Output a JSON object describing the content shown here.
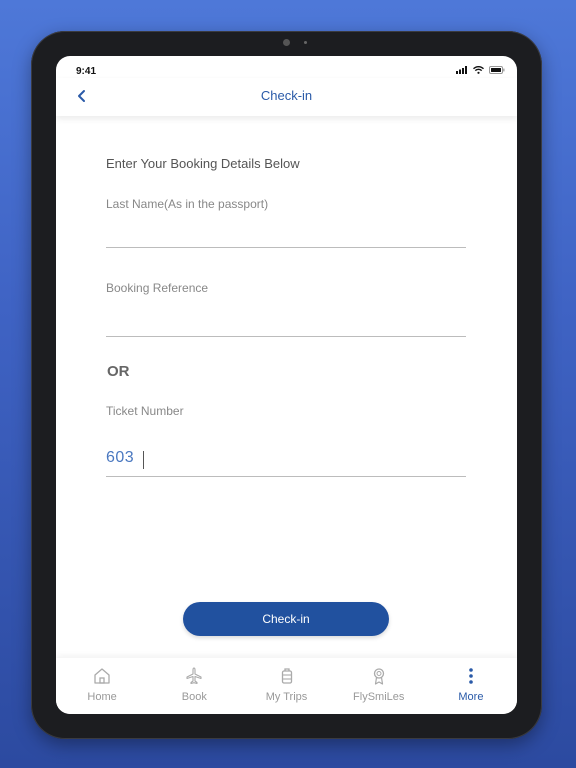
{
  "status": {
    "time": "9:41"
  },
  "navbar": {
    "title": "Check-in"
  },
  "form": {
    "heading": "Enter Your Booking Details Below",
    "last_name_label": "Last Name(As in the passport)",
    "last_name_value": "",
    "booking_ref_label": "Booking Reference",
    "booking_ref_value": "",
    "or_label": "OR",
    "ticket_label": "Ticket Number",
    "ticket_value": "603"
  },
  "button": {
    "checkin_label": "Check-in"
  },
  "colors": {
    "accent": "#2a5aa8",
    "button": "#21519f"
  },
  "tabs": [
    {
      "label": "Home",
      "icon": "home-icon"
    },
    {
      "label": "Book",
      "icon": "plane-icon"
    },
    {
      "label": "My Trips",
      "icon": "luggage-icon"
    },
    {
      "label": "FlySmiLes",
      "icon": "award-icon"
    },
    {
      "label": "More",
      "icon": "more-icon",
      "active": true
    }
  ]
}
